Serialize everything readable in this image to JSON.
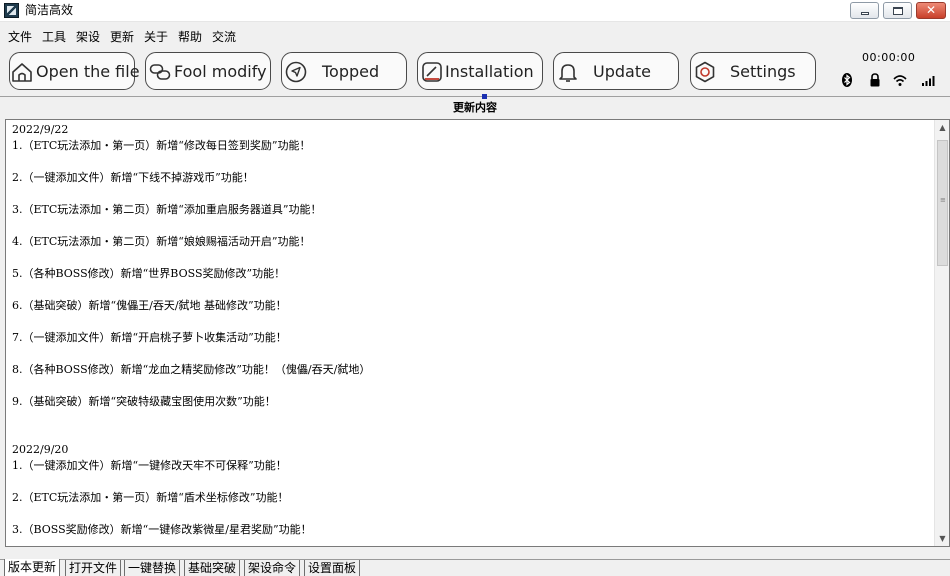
{
  "window": {
    "title": "简洁高效",
    "minimize_icon": "minimize-icon",
    "maximize_icon": "maximize-icon",
    "close_icon": "close-icon",
    "close_color": "#c8402a"
  },
  "menu": [
    "文件",
    "工具",
    "架设",
    "更新",
    "关于",
    "帮助",
    "交流"
  ],
  "toolbar": {
    "buttons": [
      {
        "label": "Open the file",
        "icon": "home-icon"
      },
      {
        "label": "Fool modify",
        "icon": "link-icon"
      },
      {
        "label": "Topped",
        "icon": "navigation-arrow-icon"
      },
      {
        "label": "Installation",
        "icon": "install-icon"
      },
      {
        "label": "Update",
        "icon": "bell-icon"
      },
      {
        "label": "Settings",
        "icon": "hexagon-settings-icon"
      }
    ]
  },
  "status": {
    "clock": "00:00:00",
    "icons": [
      "bluetooth-icon",
      "lock-icon",
      "wifi-icon",
      "signal-icon"
    ]
  },
  "section": {
    "title": "更新内容",
    "accent": "#1a2fb0"
  },
  "log": [
    "2022/9/22",
    "1.（ETC玩法添加・第一页）新增“修改每日签到奖励”功能！",
    "",
    "2.（一键添加文件）新增“下线不掉游戏币”功能！",
    "",
    "3.（ETC玩法添加・第二页）新增“添加重启服务器道具”功能！",
    "",
    "4.（ETC玩法添加・第二页）新增“娘娘赐福活动开启”功能！",
    "",
    "5.（各种BOSS修改）新增“世界BOSS奖励修改”功能！",
    "",
    "6.（基础突破）新增“傀儡王/吞天/弑地 基础修改”功能！",
    "",
    "7.（一键添加文件）新增“开启桃子萝卜收集活动”功能！",
    "",
    "8.（各种BOSS修改）新增“龙血之精奖励修改”功能！（傀儡/吞天/弑地）",
    "",
    "9.（基础突破）新增“突破特级藏宝图使用次数”功能！",
    "",
    "",
    "2022/9/20",
    "1.（一键添加文件）新增“一键修改天牢不可保释”功能！",
    "",
    "2.（ETC玩法添加・第一页）新增“盾术坐标修改”功能！",
    "",
    "3.（BOSS奖励修改）新增“一键修改紫微星/星君奖励”功能！"
  ],
  "tabs": [
    "版本更新",
    "打开文件",
    "一键替换",
    "基础突破",
    "架设命令",
    "设置面板"
  ],
  "active_tab": "版本更新"
}
